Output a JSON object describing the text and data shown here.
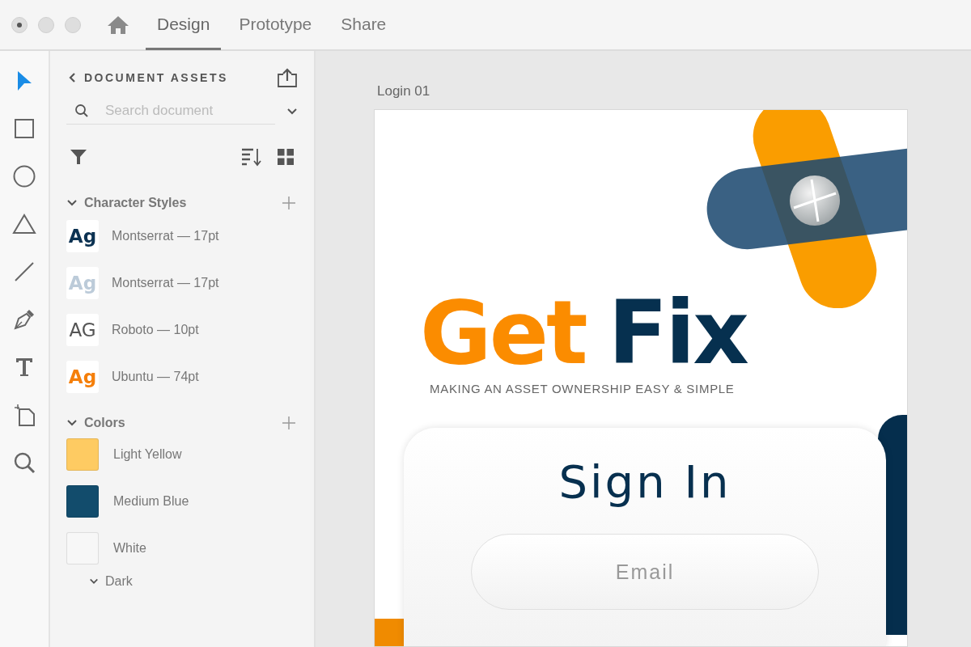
{
  "tabs": [
    {
      "label": "Design",
      "selected": true
    },
    {
      "label": "Prototype",
      "selected": false
    },
    {
      "label": "Share",
      "selected": false
    }
  ],
  "tools": [
    {
      "kind": "select",
      "selected": true
    },
    {
      "kind": "rectangle",
      "selected": false
    },
    {
      "kind": "ellipse",
      "selected": false
    },
    {
      "kind": "triangle",
      "selected": false
    },
    {
      "kind": "line",
      "selected": false
    },
    {
      "kind": "pen",
      "selected": false
    },
    {
      "kind": "text",
      "selected": false
    },
    {
      "kind": "artboard",
      "selected": false
    },
    {
      "kind": "zoom",
      "selected": false
    }
  ],
  "assets_panel": {
    "title": "DOCUMENT ASSETS",
    "search": {
      "placeholder": "Search document"
    },
    "character_styles": {
      "title": "Character Styles",
      "expanded": true,
      "items": [
        {
          "sample": "Ag",
          "color": "#0c3252",
          "bold": true,
          "label": "Montserrat — 17pt"
        },
        {
          "sample": "Ag",
          "color": "#bccbd9",
          "bold": true,
          "label": "Montserrat — 17pt"
        },
        {
          "sample": "AG",
          "color": "#555555",
          "bold": false,
          "label": "Roboto — 10pt"
        },
        {
          "sample": "Ag",
          "color": "#f57f0a",
          "bold": true,
          "label": "Ubuntu — 74pt"
        }
      ]
    },
    "colors": {
      "title": "Colors",
      "expanded": true,
      "items": [
        {
          "name": "Light Yellow",
          "color": "#fecb62"
        },
        {
          "name": "Medium Blue",
          "color": "#124c6c"
        },
        {
          "name": "White",
          "color": "#f7f7f7"
        }
      ],
      "groups": [
        {
          "label": "Dark",
          "expanded": true
        }
      ]
    }
  },
  "artboard": {
    "name": "Login 01",
    "logo_word_1": "Get",
    "logo_word_2": "Fix",
    "tagline": "MAKING AN ASSET OWNERSHIP EASY & SIMPLE",
    "card": {
      "heading": "Sign In",
      "email": {
        "placeholder": "Email"
      }
    }
  }
}
